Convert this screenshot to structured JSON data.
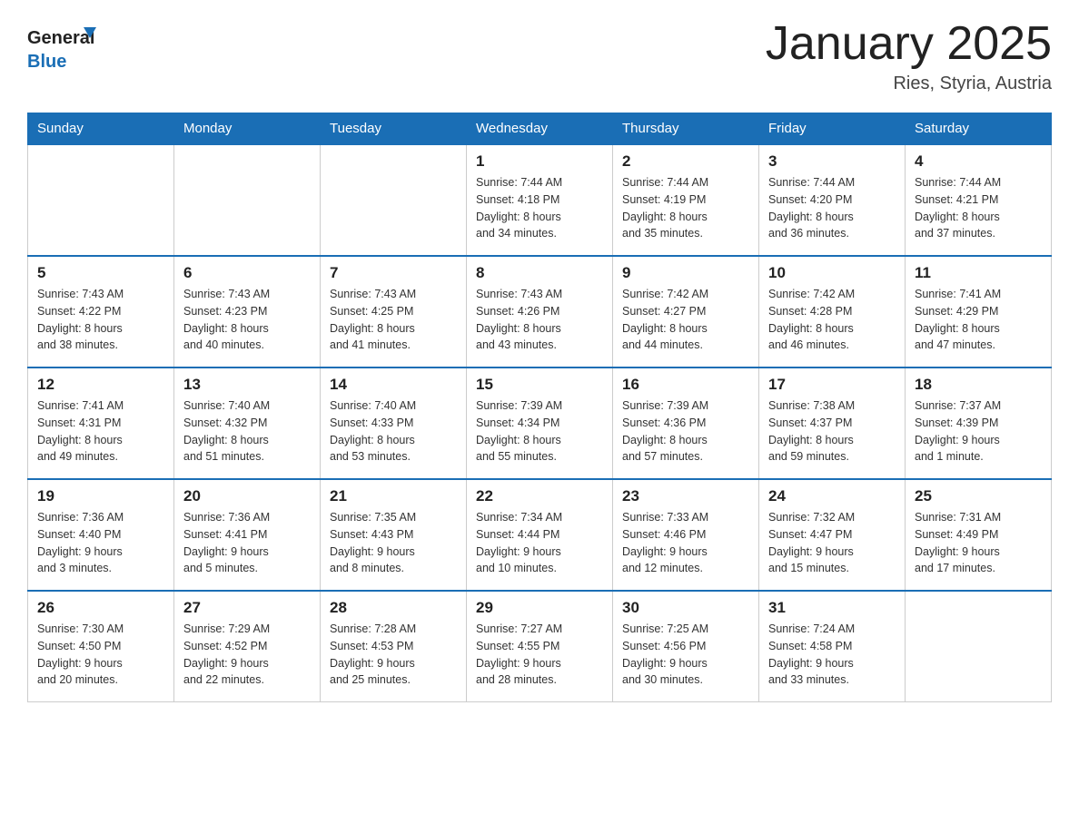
{
  "header": {
    "logo_text_general": "General",
    "logo_text_blue": "Blue",
    "title": "January 2025",
    "subtitle": "Ries, Styria, Austria"
  },
  "weekdays": [
    "Sunday",
    "Monday",
    "Tuesday",
    "Wednesday",
    "Thursday",
    "Friday",
    "Saturday"
  ],
  "weeks": [
    [
      {
        "day": "",
        "info": ""
      },
      {
        "day": "",
        "info": ""
      },
      {
        "day": "",
        "info": ""
      },
      {
        "day": "1",
        "info": "Sunrise: 7:44 AM\nSunset: 4:18 PM\nDaylight: 8 hours\nand 34 minutes."
      },
      {
        "day": "2",
        "info": "Sunrise: 7:44 AM\nSunset: 4:19 PM\nDaylight: 8 hours\nand 35 minutes."
      },
      {
        "day": "3",
        "info": "Sunrise: 7:44 AM\nSunset: 4:20 PM\nDaylight: 8 hours\nand 36 minutes."
      },
      {
        "day": "4",
        "info": "Sunrise: 7:44 AM\nSunset: 4:21 PM\nDaylight: 8 hours\nand 37 minutes."
      }
    ],
    [
      {
        "day": "5",
        "info": "Sunrise: 7:43 AM\nSunset: 4:22 PM\nDaylight: 8 hours\nand 38 minutes."
      },
      {
        "day": "6",
        "info": "Sunrise: 7:43 AM\nSunset: 4:23 PM\nDaylight: 8 hours\nand 40 minutes."
      },
      {
        "day": "7",
        "info": "Sunrise: 7:43 AM\nSunset: 4:25 PM\nDaylight: 8 hours\nand 41 minutes."
      },
      {
        "day": "8",
        "info": "Sunrise: 7:43 AM\nSunset: 4:26 PM\nDaylight: 8 hours\nand 43 minutes."
      },
      {
        "day": "9",
        "info": "Sunrise: 7:42 AM\nSunset: 4:27 PM\nDaylight: 8 hours\nand 44 minutes."
      },
      {
        "day": "10",
        "info": "Sunrise: 7:42 AM\nSunset: 4:28 PM\nDaylight: 8 hours\nand 46 minutes."
      },
      {
        "day": "11",
        "info": "Sunrise: 7:41 AM\nSunset: 4:29 PM\nDaylight: 8 hours\nand 47 minutes."
      }
    ],
    [
      {
        "day": "12",
        "info": "Sunrise: 7:41 AM\nSunset: 4:31 PM\nDaylight: 8 hours\nand 49 minutes."
      },
      {
        "day": "13",
        "info": "Sunrise: 7:40 AM\nSunset: 4:32 PM\nDaylight: 8 hours\nand 51 minutes."
      },
      {
        "day": "14",
        "info": "Sunrise: 7:40 AM\nSunset: 4:33 PM\nDaylight: 8 hours\nand 53 minutes."
      },
      {
        "day": "15",
        "info": "Sunrise: 7:39 AM\nSunset: 4:34 PM\nDaylight: 8 hours\nand 55 minutes."
      },
      {
        "day": "16",
        "info": "Sunrise: 7:39 AM\nSunset: 4:36 PM\nDaylight: 8 hours\nand 57 minutes."
      },
      {
        "day": "17",
        "info": "Sunrise: 7:38 AM\nSunset: 4:37 PM\nDaylight: 8 hours\nand 59 minutes."
      },
      {
        "day": "18",
        "info": "Sunrise: 7:37 AM\nSunset: 4:39 PM\nDaylight: 9 hours\nand 1 minute."
      }
    ],
    [
      {
        "day": "19",
        "info": "Sunrise: 7:36 AM\nSunset: 4:40 PM\nDaylight: 9 hours\nand 3 minutes."
      },
      {
        "day": "20",
        "info": "Sunrise: 7:36 AM\nSunset: 4:41 PM\nDaylight: 9 hours\nand 5 minutes."
      },
      {
        "day": "21",
        "info": "Sunrise: 7:35 AM\nSunset: 4:43 PM\nDaylight: 9 hours\nand 8 minutes."
      },
      {
        "day": "22",
        "info": "Sunrise: 7:34 AM\nSunset: 4:44 PM\nDaylight: 9 hours\nand 10 minutes."
      },
      {
        "day": "23",
        "info": "Sunrise: 7:33 AM\nSunset: 4:46 PM\nDaylight: 9 hours\nand 12 minutes."
      },
      {
        "day": "24",
        "info": "Sunrise: 7:32 AM\nSunset: 4:47 PM\nDaylight: 9 hours\nand 15 minutes."
      },
      {
        "day": "25",
        "info": "Sunrise: 7:31 AM\nSunset: 4:49 PM\nDaylight: 9 hours\nand 17 minutes."
      }
    ],
    [
      {
        "day": "26",
        "info": "Sunrise: 7:30 AM\nSunset: 4:50 PM\nDaylight: 9 hours\nand 20 minutes."
      },
      {
        "day": "27",
        "info": "Sunrise: 7:29 AM\nSunset: 4:52 PM\nDaylight: 9 hours\nand 22 minutes."
      },
      {
        "day": "28",
        "info": "Sunrise: 7:28 AM\nSunset: 4:53 PM\nDaylight: 9 hours\nand 25 minutes."
      },
      {
        "day": "29",
        "info": "Sunrise: 7:27 AM\nSunset: 4:55 PM\nDaylight: 9 hours\nand 28 minutes."
      },
      {
        "day": "30",
        "info": "Sunrise: 7:25 AM\nSunset: 4:56 PM\nDaylight: 9 hours\nand 30 minutes."
      },
      {
        "day": "31",
        "info": "Sunrise: 7:24 AM\nSunset: 4:58 PM\nDaylight: 9 hours\nand 33 minutes."
      },
      {
        "day": "",
        "info": ""
      }
    ]
  ]
}
